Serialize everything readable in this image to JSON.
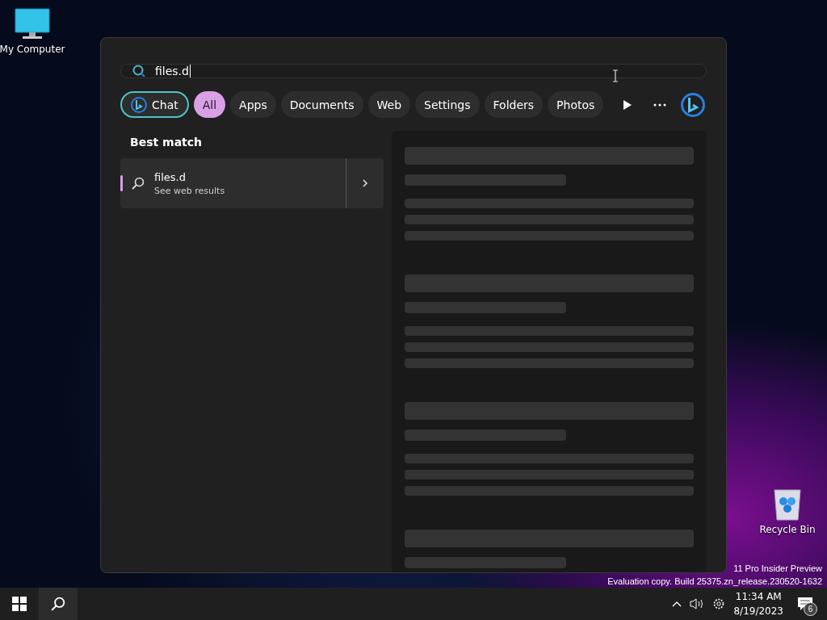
{
  "desktop_icons": [
    {
      "label": "My Computer",
      "kind": "computer"
    },
    {
      "label": "Recycle Bin",
      "kind": "recycle"
    }
  ],
  "watermark": [
    "11 Pro Insider Preview",
    "Evaluation copy. Build 25375.zn_release.230520-1632"
  ],
  "search": {
    "value": "files.d"
  },
  "filters": [
    {
      "label": "Chat",
      "kind": "chat",
      "selected": false
    },
    {
      "label": "All",
      "kind": "plain",
      "selected": true
    },
    {
      "label": "Apps",
      "kind": "plain",
      "selected": false
    },
    {
      "label": "Documents",
      "kind": "plain",
      "selected": false
    },
    {
      "label": "Web",
      "kind": "plain",
      "selected": false
    },
    {
      "label": "Settings",
      "kind": "plain",
      "selected": false
    },
    {
      "label": "Folders",
      "kind": "plain",
      "selected": false
    },
    {
      "label": "Photos",
      "kind": "plain",
      "selected": false
    }
  ],
  "best_match": {
    "heading": "Best match",
    "title": "files.d",
    "subtitle": "See web results",
    "selected": true
  },
  "taskbar": {
    "time": "11:34 AM",
    "date": "8/19/2023",
    "notifications": "6"
  }
}
